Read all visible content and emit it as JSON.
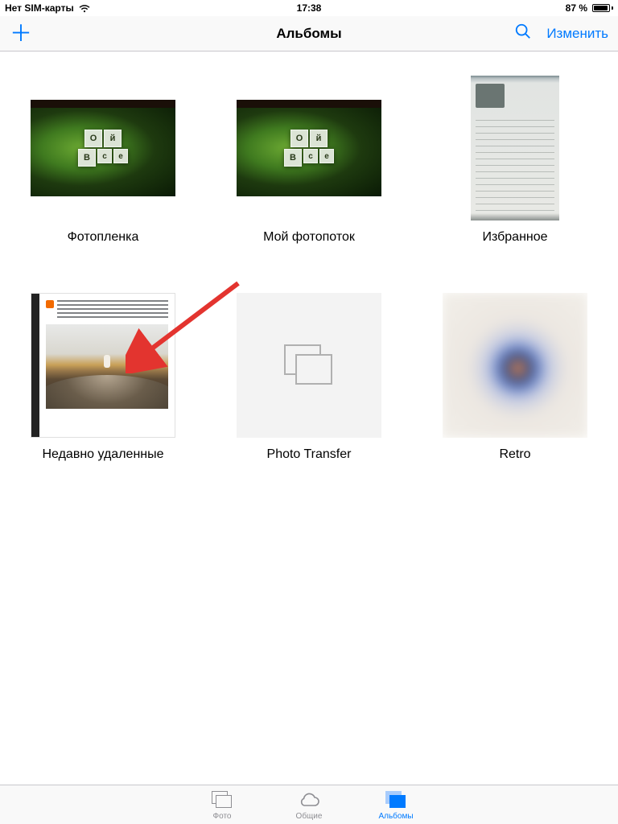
{
  "status": {
    "carrier": "Нет SIM-карты",
    "time": "17:38",
    "battery_percent": "87 %"
  },
  "nav": {
    "title": "Альбомы",
    "edit": "Изменить"
  },
  "albums": [
    {
      "label": "Фотопленка"
    },
    {
      "label": "Мой фотопоток"
    },
    {
      "label": "Избранное"
    },
    {
      "label": "Недавно удаленные"
    },
    {
      "label": "Photo Transfer"
    },
    {
      "label": "Retro"
    }
  ],
  "tabs": {
    "photos": "Фото",
    "shared": "Общие",
    "albums": "Альбомы"
  },
  "green_tiles": {
    "o": "О",
    "i": "й",
    "b": "В",
    "s1": "с",
    "s2": "е"
  }
}
